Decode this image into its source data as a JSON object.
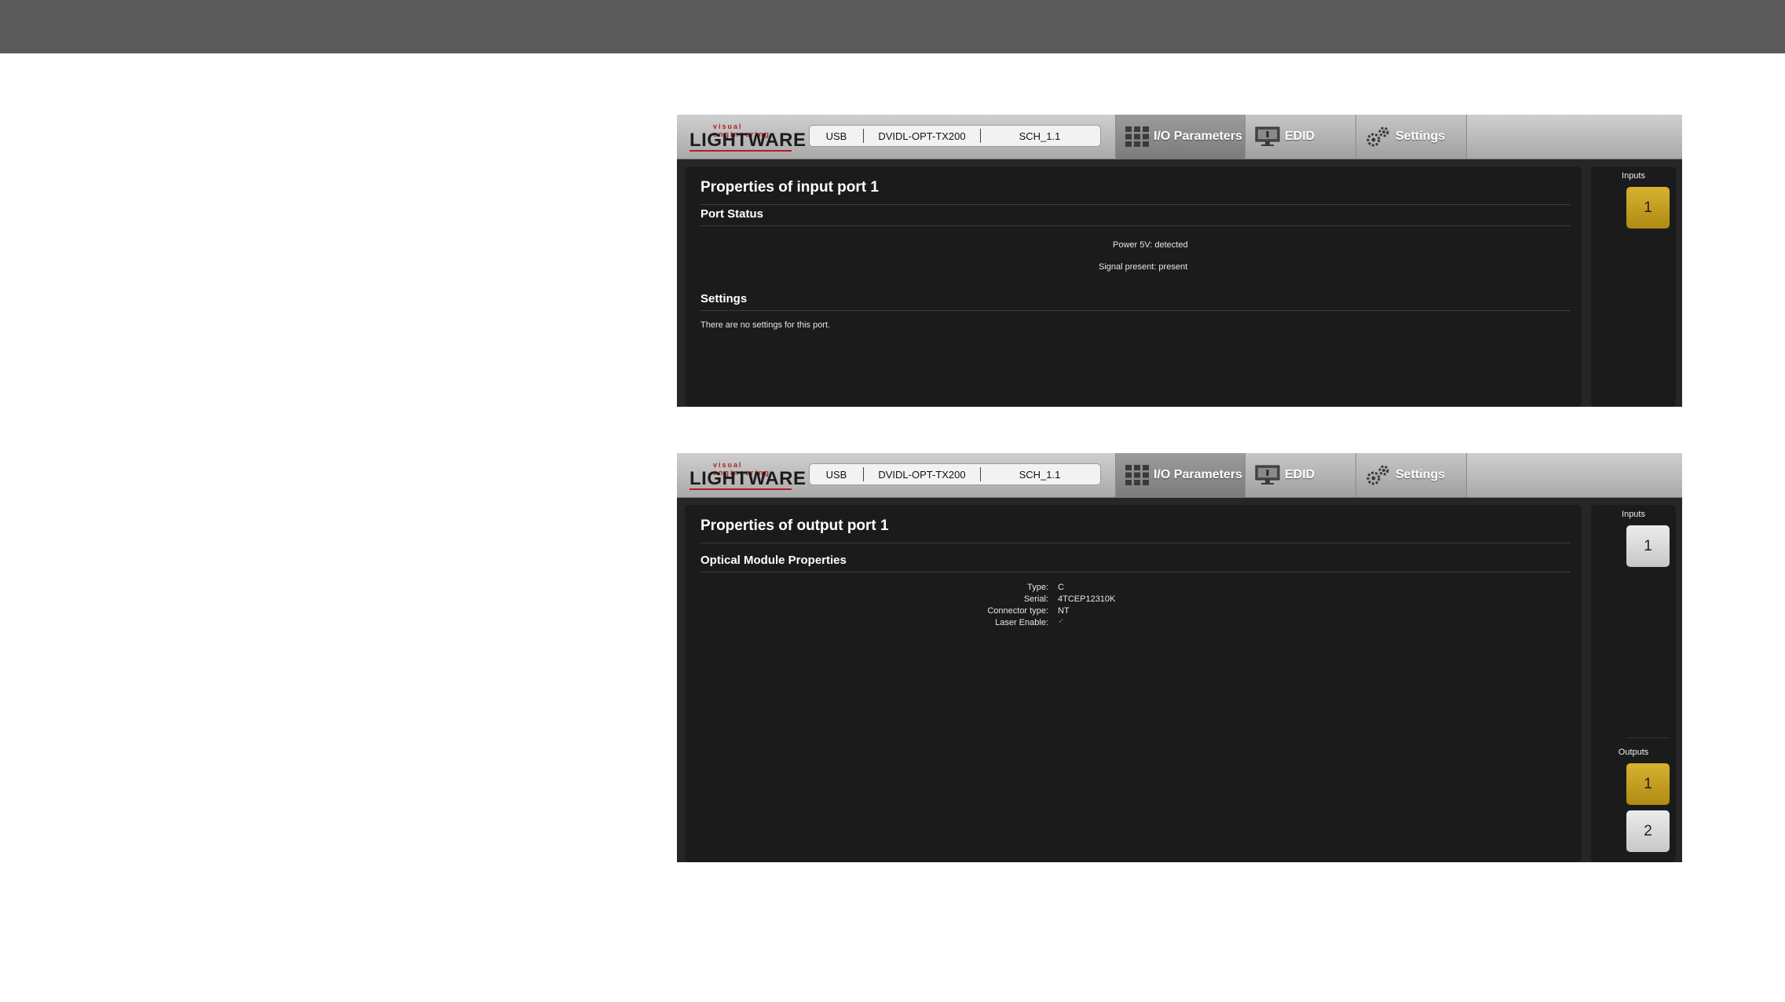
{
  "header": {
    "logo_tagline": "visual engineering",
    "logo_brand": "LIGHTWARE",
    "device": {
      "connection": "USB",
      "model": "DVIDL-OPT-TX200",
      "sch": "SCH_1.1"
    },
    "tabs": {
      "io": "I/O Parameters",
      "edid": "EDID",
      "settings": "Settings"
    }
  },
  "input_panel": {
    "title": "Properties of input port 1",
    "status_heading": "Port Status",
    "power_5v": "Power 5V: detected",
    "signal_present": "Signal present: present",
    "settings_heading": "Settings",
    "settings_text": "There are no settings for this port."
  },
  "output_panel": {
    "title": "Properties of output port 1",
    "optical_heading": "Optical Module Properties",
    "properties": [
      {
        "key": "Type:",
        "value": "C"
      },
      {
        "key": "Serial:",
        "value": "4TCEP12310K"
      },
      {
        "key": "Connector type:",
        "value": "NT"
      },
      {
        "key": "Laser Enable:",
        "value": "✓"
      }
    ]
  },
  "sidebar": {
    "inputs_label": "Inputs",
    "outputs_label": "Outputs",
    "input_ports": [
      "1"
    ],
    "output_ports": [
      "1",
      "2"
    ]
  },
  "colors": {
    "selected_port": "#c9a222",
    "laser_check": "#2e9a2e",
    "brand_red": "#b01e23"
  }
}
